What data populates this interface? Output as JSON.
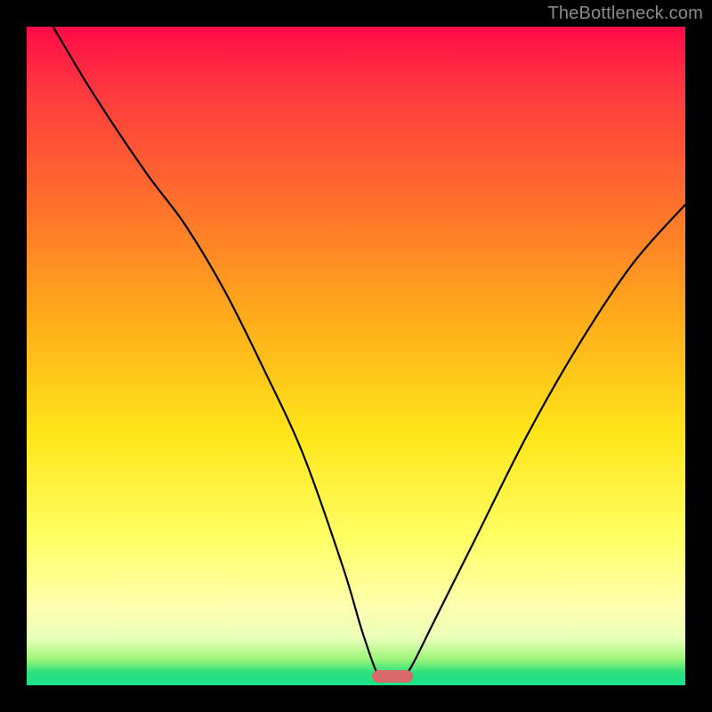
{
  "attribution": "TheBottleneck.com",
  "chart_data": {
    "type": "line",
    "title": "",
    "xlabel": "",
    "ylabel": "",
    "xlim": [
      0,
      100
    ],
    "ylim": [
      0,
      100
    ],
    "series": [
      {
        "name": "curve",
        "x": [
          4,
          10,
          18,
          24,
          30,
          36,
          42,
          48,
          51,
          53.5,
          55,
          57,
          58.5,
          62,
          68,
          76,
          84,
          92,
          100
        ],
        "y": [
          100,
          90,
          78,
          70,
          60,
          48,
          35,
          18,
          8,
          1.2,
          0.8,
          1.2,
          3,
          10,
          22,
          38,
          52,
          64,
          73
        ]
      }
    ],
    "marker": {
      "x": 55.5,
      "y": 1.4
    },
    "gradient_stops": [
      {
        "pos": 0,
        "color": "#ff0a47"
      },
      {
        "pos": 10,
        "color": "#ff3a3f"
      },
      {
        "pos": 25,
        "color": "#ff6a2e"
      },
      {
        "pos": 45,
        "color": "#ffae1a"
      },
      {
        "pos": 62,
        "color": "#ffe61a"
      },
      {
        "pos": 78,
        "color": "#ffff66"
      },
      {
        "pos": 88,
        "color": "#ffffb0"
      },
      {
        "pos": 93,
        "color": "#e9ffb8"
      },
      {
        "pos": 96,
        "color": "#9df47a"
      },
      {
        "pos": 98,
        "color": "#2fe07a"
      },
      {
        "pos": 100,
        "color": "#18e28b"
      }
    ]
  }
}
